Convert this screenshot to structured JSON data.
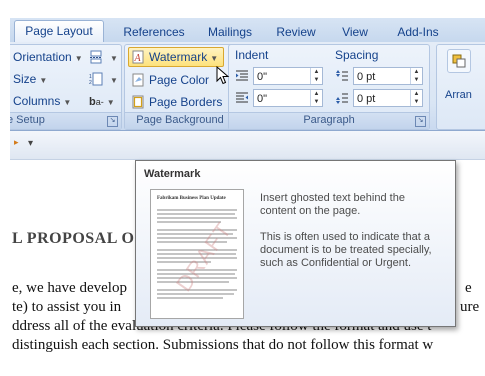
{
  "tabs": [
    "Page Layout",
    "References",
    "Mailings",
    "Review",
    "View",
    "Add-Ins"
  ],
  "page_setup": {
    "orientation": "Orientation",
    "size": "Size",
    "columns": "Columns",
    "group_label": "e Setup"
  },
  "page_background": {
    "watermark": "Watermark",
    "page_color": "Page Color",
    "page_borders": "Page Borders",
    "group_label": "Page Background"
  },
  "paragraph": {
    "indent_label": "Indent",
    "spacing_label": "Spacing",
    "indent_left": "0\"",
    "indent_right": "0\"",
    "spacing_before": "0 pt",
    "spacing_after": "0 pt",
    "group_label": "Paragraph"
  },
  "arrange": {
    "label": "Arran"
  },
  "qat": {
    "glyph": "▾"
  },
  "tooltip": {
    "title": "Watermark",
    "line1": "Insert ghosted text behind the",
    "line2": "content on the page.",
    "line3": "This is often used to indicate that a",
    "line4": "document is to be treated specially,",
    "line5": "such as Confidential or Urgent.",
    "thumb_heading": "Fabrikam Business Plan Update",
    "thumb_watermark": "DRAFT"
  },
  "document": {
    "line1": "L PROPOSAL O",
    "line2": "e, we have develop",
    "line2_end": "e",
    "line3": "te) to assist you in",
    "line3_end": "ure",
    "line4": "ddress all of the evaluation criteria.  Please follow the format and use t",
    "line5": "distinguish each section.  Submissions that do not follow this format w"
  },
  "colors": {
    "ribbon": "#dde8f6",
    "tab_text": "#15428b",
    "watermark_highlight": "#fde27c",
    "tooltip_border": "#767676"
  }
}
